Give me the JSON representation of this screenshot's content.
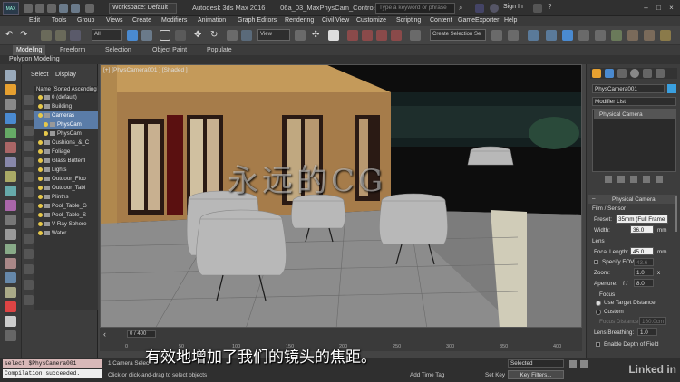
{
  "titlebar": {
    "logo": "MAX",
    "workspace": "Workspace: Default",
    "app_title": "Autodesk 3ds Max 2016",
    "file_title": "06a_03_MaxPhysCam_Controls.max",
    "search_placeholder": "Type a keyword or phrase",
    "sign_in": "Sign In"
  },
  "menu": [
    "Edit",
    "Tools",
    "Group",
    "Views",
    "Create",
    "Modifiers",
    "Animation",
    "Graph Editors",
    "Rendering",
    "Civil View",
    "Customize",
    "Scripting",
    "Content",
    "GameExporter",
    "Help"
  ],
  "toolbar": {
    "filter": "All",
    "view": "View",
    "selection_set": "Create Selection Se"
  },
  "ribbon": {
    "tabs": [
      "Modeling",
      "Freeform",
      "Selection",
      "Object Paint",
      "Populate"
    ],
    "sub": "Polygon Modeling"
  },
  "scene_explorer": {
    "tabs": [
      "Select",
      "Display"
    ],
    "header": "Name (Sorted Ascending",
    "rows": [
      {
        "label": "0 (default)",
        "indent": 0,
        "selected": false
      },
      {
        "label": "Building",
        "indent": 0,
        "selected": false
      },
      {
        "label": "Cameras",
        "indent": 0,
        "selected": true
      },
      {
        "label": "PhysCam",
        "indent": 1,
        "selected": true
      },
      {
        "label": "PhysCam",
        "indent": 1,
        "selected": false
      },
      {
        "label": "Cushions_&_C",
        "indent": 0,
        "selected": false
      },
      {
        "label": "Foliage",
        "indent": 0,
        "selected": false
      },
      {
        "label": "Glass Butterfl",
        "indent": 0,
        "selected": false
      },
      {
        "label": "Lights",
        "indent": 0,
        "selected": false
      },
      {
        "label": "Outdoor_Floo",
        "indent": 0,
        "selected": false
      },
      {
        "label": "Outdoor_Tabl",
        "indent": 0,
        "selected": false
      },
      {
        "label": "Plinths",
        "indent": 0,
        "selected": false
      },
      {
        "label": "Pool_Table_G",
        "indent": 0,
        "selected": false
      },
      {
        "label": "Pool_Table_S",
        "indent": 0,
        "selected": false
      },
      {
        "label": "V-Ray Sphere",
        "indent": 0,
        "selected": false
      },
      {
        "label": "Water",
        "indent": 0,
        "selected": false
      }
    ]
  },
  "viewport": {
    "label": "[+] [PhysCamera001 ] [Shaded ]",
    "watermark": "永远的CG"
  },
  "command_panel": {
    "object_name": "PhysCamera001",
    "modifier_list": "Modifier List",
    "stack_item": "Physical Camera",
    "rollout": "Physical Camera",
    "film_sensor": "Film / Sensor",
    "preset_label": "Preset:",
    "preset_value": "35mm (Full Frame",
    "width_label": "Width:",
    "width_value": "36.0",
    "width_unit": "mm",
    "lens": "Lens",
    "focal_label": "Focal Length:",
    "focal_value": "45.0",
    "focal_unit": "mm",
    "specify_fov": "Specify FOV:",
    "fov_value": "43.6",
    "zoom_label": "Zoom:",
    "zoom_value": "1.0",
    "zoom_unit": "x",
    "aperture_label": "Aperture:",
    "aperture_f": "f /",
    "aperture_value": "8.0",
    "focus": "Focus",
    "use_target": "Use Target Distance",
    "custom": "Custom",
    "focus_distance_label": "Focus Distance:",
    "focus_distance_value": "160.0cm",
    "lens_breathing_label": "Lens Breathing:",
    "lens_breathing_value": "1.0",
    "enable_dof": "Enable Depth of Field"
  },
  "timeline": {
    "frame": "0 / 400",
    "ticks": [
      "0",
      "50",
      "100",
      "150",
      "200",
      "250",
      "300",
      "350",
      "400"
    ]
  },
  "subtitle": "有效地增加了我们的镜头的焦距。",
  "status": {
    "listener_cmd": "select $PhysCamera001",
    "listener_out": "Compilation succeeded.",
    "selected_count": "1 Camera Selec",
    "prompt": "Click or click-and-drag to select objects",
    "add_time_tag": "Add Time Tag",
    "set_key": "Set Key",
    "key_filters": "Key Filters...",
    "selected": "Selected",
    "brand": "Linked in"
  }
}
